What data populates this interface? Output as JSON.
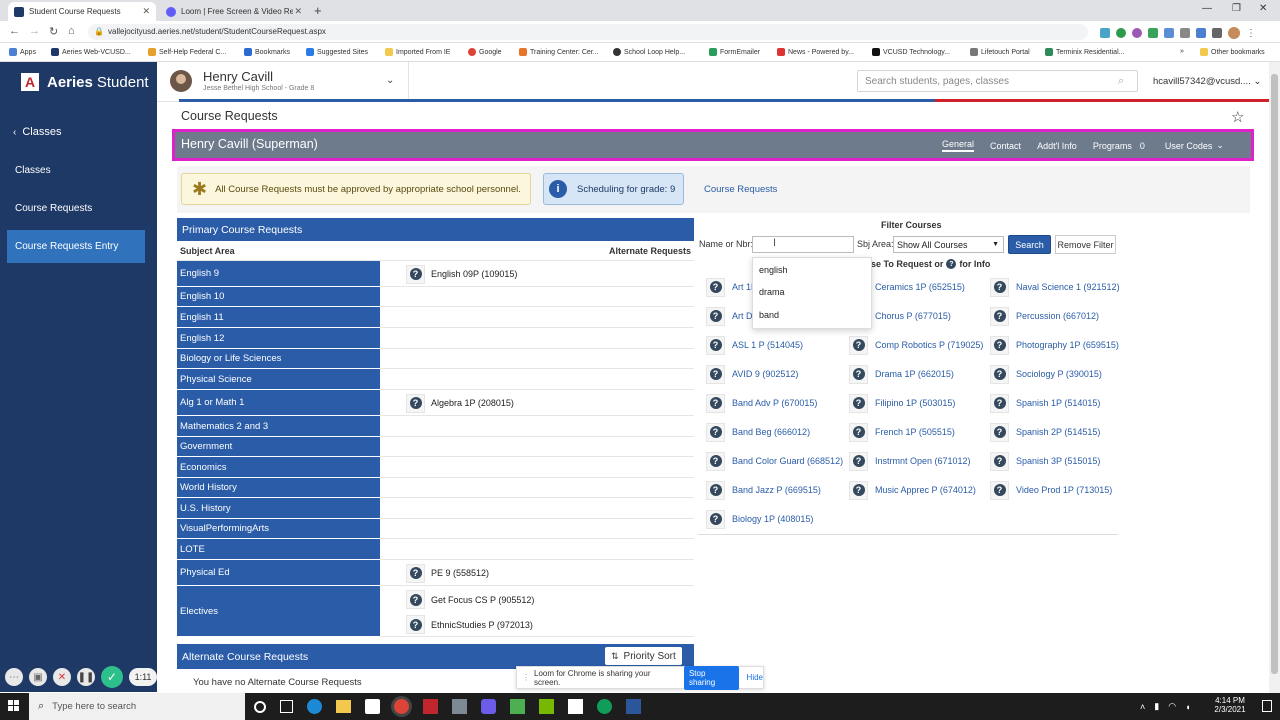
{
  "browser": {
    "tabs": [
      {
        "title": "Student Course Requests",
        "active": true
      },
      {
        "title": "Loom | Free Screen & Video Rec",
        "active": false
      }
    ],
    "url": "vallejocityusd.aeries.net/student/StudentCourseRequest.aspx",
    "bookmarks": [
      "Apps",
      "Aeries Web-VCUSD...",
      "Self-Help Federal C...",
      "Bookmarks",
      "Suggested Sites",
      "Imported From IE",
      "Google",
      "Training Center: Cer...",
      "School Loop Help...",
      "FormEmailer",
      "News - Powered by...",
      "VCUSD Technology...",
      "Lifetouch Portal",
      "Terminix Residential...",
      "Other bookmarks"
    ],
    "overflow": "»"
  },
  "app": {
    "brand_bold": "Aeries",
    "brand_light": "Student",
    "student_name": "Henry Cavill",
    "student_school": "Jesse Bethel High School - Grade 8",
    "search_placeholder": "Search students, pages, classes",
    "user": "hcavill57342@vcusd...."
  },
  "sidebar": {
    "back_label": "Classes",
    "items": [
      {
        "label": "Classes",
        "selected": false
      },
      {
        "label": "Course Requests",
        "selected": false
      },
      {
        "label": "Course Requests Entry",
        "selected": true
      }
    ]
  },
  "page": {
    "title": "Course Requests",
    "student_banner": "Henry Cavill (Superman)",
    "tabs": [
      "General",
      "Contact",
      "Addt'l Info",
      "Programs",
      "User Codes"
    ],
    "programs_count": "0",
    "notice": "All Course Requests must be approved by appropriate school personnel.",
    "scheduling": "Scheduling for grade: 9",
    "course_requests_link": "Course Requests"
  },
  "primary": {
    "header": "Primary Course Requests",
    "col_subject": "Subject Area",
    "col_alternate": "Alternate Requests",
    "rows": [
      {
        "subject": "English 9",
        "courses": [
          "English 09P (109015)"
        ]
      },
      {
        "subject": "English 10",
        "courses": []
      },
      {
        "subject": "English 11",
        "courses": []
      },
      {
        "subject": "English 12",
        "courses": []
      },
      {
        "subject": "Biology or Life Sciences",
        "courses": []
      },
      {
        "subject": "Physical Science",
        "courses": []
      },
      {
        "subject": "Alg 1 or Math 1",
        "courses": [
          "Algebra 1P (208015)"
        ]
      },
      {
        "subject": "Mathematics 2 and 3",
        "courses": []
      },
      {
        "subject": "Government",
        "courses": []
      },
      {
        "subject": "Economics",
        "courses": []
      },
      {
        "subject": "World History",
        "courses": []
      },
      {
        "subject": "U.S. History",
        "courses": []
      },
      {
        "subject": "VisualPerformingArts",
        "courses": []
      },
      {
        "subject": "LOTE",
        "courses": []
      },
      {
        "subject": "Physical Ed",
        "courses": [
          "PE 9 (558512)"
        ]
      },
      {
        "subject": "Electives",
        "courses": [
          "Get Focus CS P (905512)",
          "EthnicStudies P (972013)"
        ]
      }
    ]
  },
  "alternate": {
    "header": "Alternate Course Requests",
    "priority_sort": "Priority Sort",
    "empty": "You have no Alternate Course Requests"
  },
  "filter": {
    "title": "Filter Courses",
    "name_label": "Name or Nbr:",
    "name_value": "",
    "sbj_label": "Sbj Area:",
    "sbj_value": "Show All Courses",
    "search_btn": "Search",
    "remove_btn": "Remove Filter",
    "hint_prefix": "urse To Request or",
    "hint_suffix": "for Info",
    "autocomplete": [
      "english",
      "drama",
      "band"
    ]
  },
  "courses": [
    [
      "Art 1P",
      "Ceramics 1P (652515)",
      "Naval Science 1 (921512)"
    ],
    [
      "Art Di",
      "Chorus P (677015)",
      "Percussion (667012)"
    ],
    [
      "ASL 1 P (514045)",
      "Comp Robotics P (719025)",
      "Photography 1P (659515)"
    ],
    [
      "AVID 9 (902512)",
      "Drama 1P (662015)",
      "Sociology P (390015)"
    ],
    [
      "Band Adv P (670015)",
      "Filipino 1P (503015)",
      "Spanish 1P (514015)"
    ],
    [
      "Band Beg (666012)",
      "French 1P (505515)",
      "Spanish 2P (514515)"
    ],
    [
      "Band Color Guard (668512)",
      "Instrmnt Open (671012)",
      "Spanish 3P (515015)"
    ],
    [
      "Band Jazz P (669515)",
      "Music Apprec P (674012)",
      "Video Prod 1P (713015)"
    ],
    [
      "Biology 1P (408015)",
      "",
      ""
    ]
  ],
  "loom": {
    "timer": "1:11",
    "sharing_text": "Loom for Chrome is sharing your screen.",
    "stop_btn": "Stop sharing",
    "hide_btn": "Hide"
  },
  "taskbar": {
    "search_placeholder": "Type here to search",
    "time": "4:14 PM",
    "date": "2/3/2021"
  },
  "colors": {
    "sidebar": "#1e3966",
    "primary_blue": "#2a5ca8",
    "banner": "#6d7b8d",
    "banner_outline": "#e020c8"
  }
}
